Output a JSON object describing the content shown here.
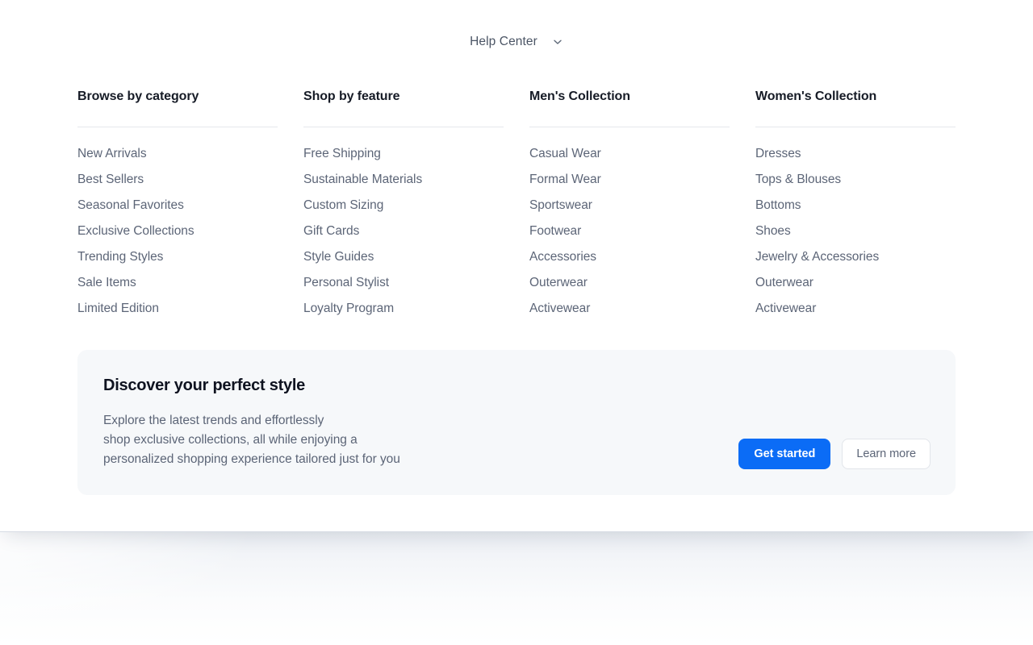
{
  "trigger": {
    "label": "Help Center",
    "icon": "chevron-down-icon"
  },
  "columns": [
    {
      "title": "Browse by category",
      "links": [
        "New Arrivals",
        "Best Sellers",
        "Seasonal Favorites",
        "Exclusive Collections",
        "Trending Styles",
        "Sale Items",
        "Limited Edition"
      ]
    },
    {
      "title": "Shop by feature",
      "links": [
        "Free Shipping",
        "Sustainable Materials",
        "Custom Sizing",
        "Gift Cards",
        "Style Guides",
        "Personal Stylist",
        "Loyalty Program"
      ]
    },
    {
      "title": "Men's Collection",
      "links": [
        "Casual Wear",
        "Formal Wear",
        "Sportswear",
        "Footwear",
        "Accessories",
        "Outerwear",
        "Activewear"
      ]
    },
    {
      "title": "Women's Collection",
      "links": [
        "Dresses",
        "Tops & Blouses",
        "Bottoms",
        "Shoes",
        "Jewelry & Accessories",
        "Outerwear",
        "Activewear"
      ]
    }
  ],
  "promo": {
    "title": "Discover your perfect style",
    "body_lines": [
      "Explore the latest trends and effortlessly",
      "shop exclusive collections, all while enjoying a",
      "personalized shopping experience tailored just for you"
    ],
    "primary_button": "Get started",
    "secondary_button": "Learn more"
  },
  "colors": {
    "accent_blue": "#0b6cf6",
    "card_background": "#f6f8fa",
    "heading_text": "#161b26",
    "link_text": "#5c6577",
    "divider": "#e6e8ec"
  }
}
